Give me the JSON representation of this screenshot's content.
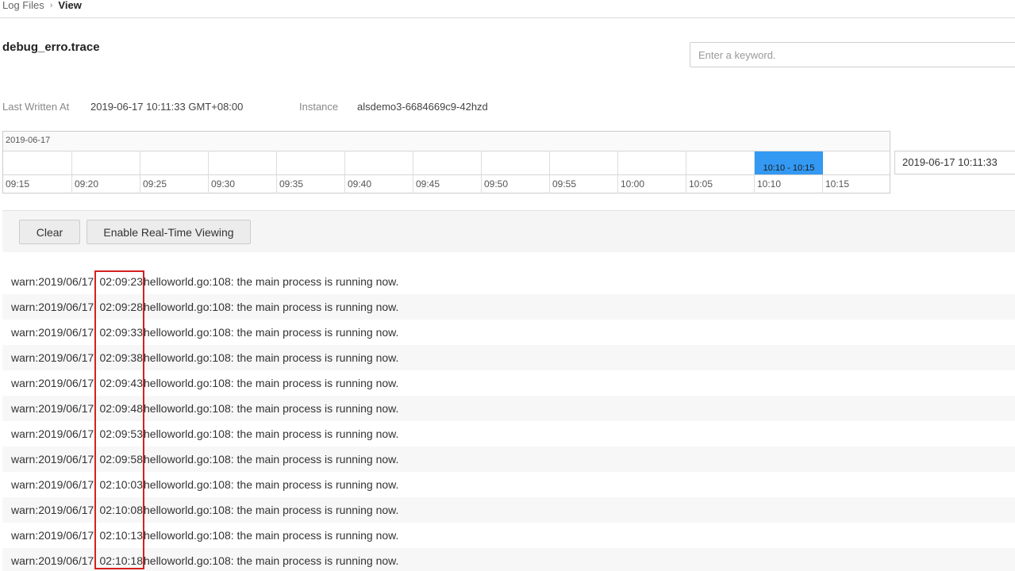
{
  "breadcrumb": {
    "parent": "Log Files",
    "separator": "›",
    "current": "View"
  },
  "file": {
    "name": "debug_erro.trace"
  },
  "search": {
    "placeholder": "Enter a keyword."
  },
  "meta": {
    "last_written_label": "Last Written At",
    "last_written_value": "2019-06-17 10:11:33 GMT+08:00",
    "instance_label": "Instance",
    "instance_value": "alsdemo3-6684669c9-42hzd"
  },
  "timeline": {
    "date": "2019-06-17",
    "ticks": [
      "09:15",
      "09:20",
      "09:25",
      "09:30",
      "09:35",
      "09:40",
      "09:45",
      "09:50",
      "09:55",
      "10:00",
      "10:05",
      "10:10",
      "10:15"
    ],
    "selected_range": "10:10 - 10:15",
    "selected_color": "#3399f3",
    "datetime_value": "2019-06-17 10:11:33"
  },
  "toolbar": {
    "clear_label": "Clear",
    "realtime_label": "Enable Real-Time Viewing"
  },
  "logs": [
    {
      "prefix": "warn:2019/06/17",
      "time": "02:09:23",
      "message": "helloworld.go:108: the main process is running now."
    },
    {
      "prefix": "warn:2019/06/17",
      "time": "02:09:28",
      "message": "helloworld.go:108: the main process is running now."
    },
    {
      "prefix": "warn:2019/06/17",
      "time": "02:09:33",
      "message": "helloworld.go:108: the main process is running now."
    },
    {
      "prefix": "warn:2019/06/17",
      "time": "02:09:38",
      "message": "helloworld.go:108: the main process is running now."
    },
    {
      "prefix": "warn:2019/06/17",
      "time": "02:09:43",
      "message": "helloworld.go:108: the main process is running now."
    },
    {
      "prefix": "warn:2019/06/17",
      "time": "02:09:48",
      "message": "helloworld.go:108: the main process is running now."
    },
    {
      "prefix": "warn:2019/06/17",
      "time": "02:09:53",
      "message": "helloworld.go:108: the main process is running now."
    },
    {
      "prefix": "warn:2019/06/17",
      "time": "02:09:58",
      "message": "helloworld.go:108: the main process is running now."
    },
    {
      "prefix": "warn:2019/06/17",
      "time": "02:10:03",
      "message": "helloworld.go:108: the main process is running now."
    },
    {
      "prefix": "warn:2019/06/17",
      "time": "02:10:08",
      "message": "helloworld.go:108: the main process is running now."
    },
    {
      "prefix": "warn:2019/06/17",
      "time": "02:10:13",
      "message": "helloworld.go:108: the main process is running now."
    },
    {
      "prefix": "warn:2019/06/17",
      "time": "02:10:18",
      "message": "helloworld.go:108: the main process is running now."
    }
  ],
  "annotation": {
    "highlight_color": "#d62020"
  }
}
